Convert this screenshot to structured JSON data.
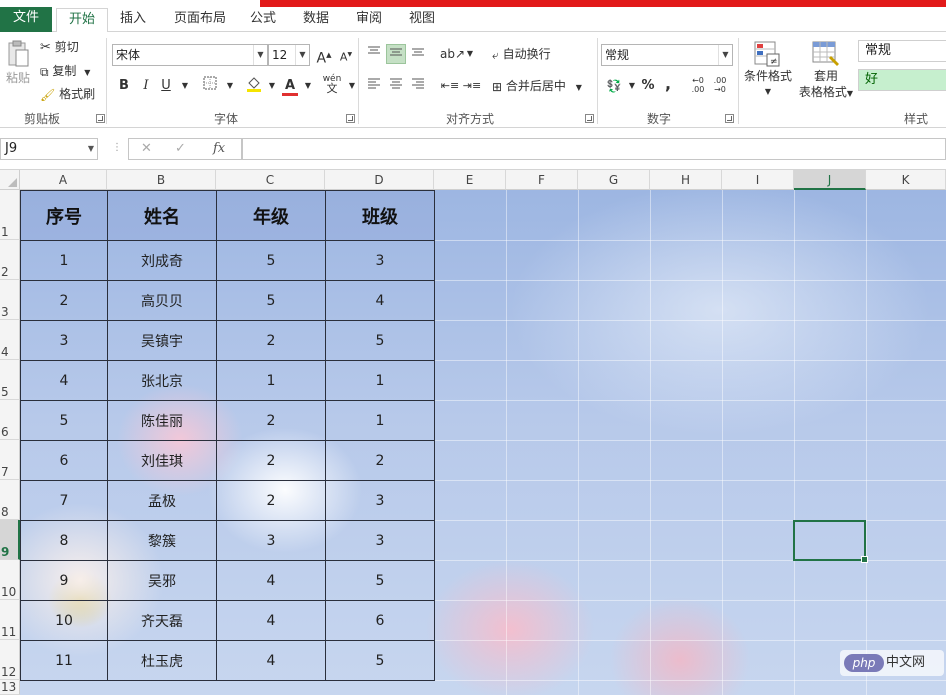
{
  "tabs": {
    "file": "文件",
    "items": [
      "开始",
      "插入",
      "页面布局",
      "公式",
      "数据",
      "审阅",
      "视图"
    ]
  },
  "clipboard": {
    "paste": "粘贴",
    "cut": "剪切",
    "copy": "复制",
    "format_painter": "格式刷",
    "label": "剪贴板"
  },
  "font": {
    "name": "宋体",
    "size": "12",
    "bold": "B",
    "italic": "I",
    "underline": "U",
    "grow": "A",
    "shrink": "A",
    "phonetic": "wén",
    "label": "字体",
    "color_accent": "#e03030",
    "fill_accent": "#f5e400"
  },
  "alignment": {
    "wrap": "自动换行",
    "merge": "合并后居中",
    "label": "对齐方式"
  },
  "number": {
    "format": "常规",
    "percent": "%",
    "comma": ",",
    "label": "数字"
  },
  "styles": {
    "conditional": "条件格式",
    "table_format_1": "套用",
    "table_format_2": "表格格式",
    "normal": "常规",
    "good": "好",
    "label": "样式"
  },
  "formula_bar": {
    "name_box": "J9",
    "cancel": "✕",
    "enter": "✓",
    "fx": "fx",
    "value": ""
  },
  "columns": [
    "A",
    "B",
    "C",
    "D",
    "E",
    "F",
    "G",
    "H",
    "I",
    "J",
    "K"
  ],
  "rows": [
    "1",
    "2",
    "3",
    "4",
    "5",
    "6",
    "7",
    "8",
    "9",
    "10",
    "11",
    "12",
    "13"
  ],
  "table": {
    "headers": [
      "序号",
      "姓名",
      "年级",
      "班级"
    ],
    "rows": [
      [
        "1",
        "刘成奇",
        "5",
        "3"
      ],
      [
        "2",
        "高贝贝",
        "5",
        "4"
      ],
      [
        "3",
        "吴镇宇",
        "2",
        "5"
      ],
      [
        "4",
        "张北京",
        "1",
        "1"
      ],
      [
        "5",
        "陈佳丽",
        "2",
        "1"
      ],
      [
        "6",
        "刘佳琪",
        "2",
        "2"
      ],
      [
        "7",
        "孟极",
        "2",
        "3"
      ],
      [
        "8",
        "黎簇",
        "3",
        "3"
      ],
      [
        "9",
        "吴邪",
        "4",
        "5"
      ],
      [
        "10",
        "齐天磊",
        "4",
        "6"
      ],
      [
        "11",
        "杜玉虎",
        "4",
        "5"
      ]
    ]
  },
  "selected_cell": "J9",
  "watermark": {
    "logo": "php",
    "text": "中文网"
  },
  "accent": "#217346"
}
